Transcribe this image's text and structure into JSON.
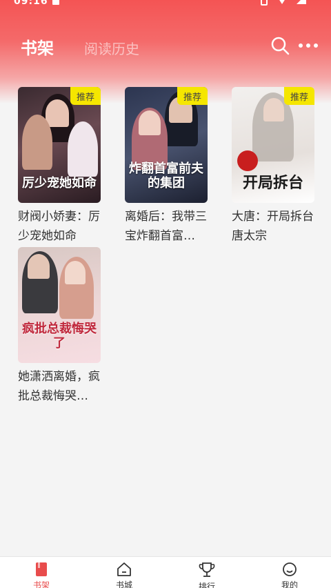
{
  "status": {
    "time": "09:16"
  },
  "header": {
    "tabs": [
      {
        "label": "书架",
        "active": true
      },
      {
        "label": "阅读历史",
        "active": false
      }
    ]
  },
  "books": [
    {
      "title": "财阀小娇妻：厉少宠她如命",
      "cover_text": "厉少宠她如命",
      "badge": "推荐"
    },
    {
      "title": "离婚后：我带三宝炸翻首富…",
      "cover_text": "炸翻首富前夫的集团",
      "badge": "推荐"
    },
    {
      "title": "大唐：开局拆台唐太宗",
      "cover_text": "开局拆台",
      "badge": "推荐"
    },
    {
      "title": "她潇洒离婚，疯批总裁悔哭…",
      "cover_text": "疯批总裁悔哭了",
      "badge": ""
    }
  ],
  "bottom_nav": [
    {
      "label": "书架",
      "icon": "bookshelf-icon",
      "active": true
    },
    {
      "label": "书城",
      "icon": "store-icon",
      "active": false
    },
    {
      "label": "排行",
      "icon": "trophy-icon",
      "active": false
    },
    {
      "label": "我的",
      "icon": "profile-icon",
      "active": false
    }
  ],
  "colors": {
    "accent": "#e84c4c",
    "header": "#f45454",
    "badge": "#f5e600"
  }
}
